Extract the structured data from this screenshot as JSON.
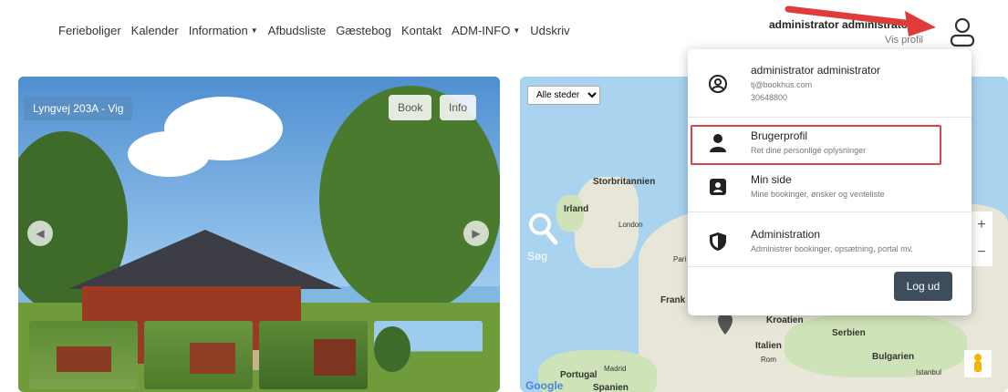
{
  "nav": {
    "items": [
      "Ferieboliger",
      "Kalender",
      "Information",
      "Afbudsliste",
      "Gæstebog",
      "Kontakt",
      "ADM-INFO",
      "Udskriv"
    ]
  },
  "user": {
    "name": "administrator administrator",
    "vis_profil": "Vis profil"
  },
  "gallery": {
    "place_label": "Lyngvej 203A - Vig",
    "book_label": "Book",
    "info_label": "Info"
  },
  "map": {
    "select_value": "Alle steder",
    "sog_label": "Søg",
    "labels": {
      "storbritannien": "Storbritannien",
      "irland": "Irland",
      "london": "London",
      "paris": "Pari",
      "frank": "Frank",
      "kroatien": "Kroatien",
      "serbien": "Serbien",
      "italien": "Italien",
      "rom": "Rom",
      "bulgarien": "Bulgarien",
      "istanbul": "Istanbul",
      "portugal": "Portugal",
      "madrid": "Madrid",
      "spanien": "Spanien",
      "google": "Google"
    }
  },
  "dropdown": {
    "account_name": "administrator administrator",
    "account_email": "tj@bookhus.com",
    "account_phone": "30648800",
    "profile_title": "Brugerprofil",
    "profile_sub": "Ret dine personlige oplysninger",
    "minside_title": "Min side",
    "minside_sub": "Mine bookinger, ønsker og venteliste",
    "admin_title": "Administration",
    "admin_sub": "Administrer bookinger, opsætning, portal mv.",
    "logout_label": "Log ud"
  },
  "colors": {
    "highlight": "#d94545",
    "arrow": "#e03a3a",
    "logout_bg": "#3d4d5b"
  }
}
